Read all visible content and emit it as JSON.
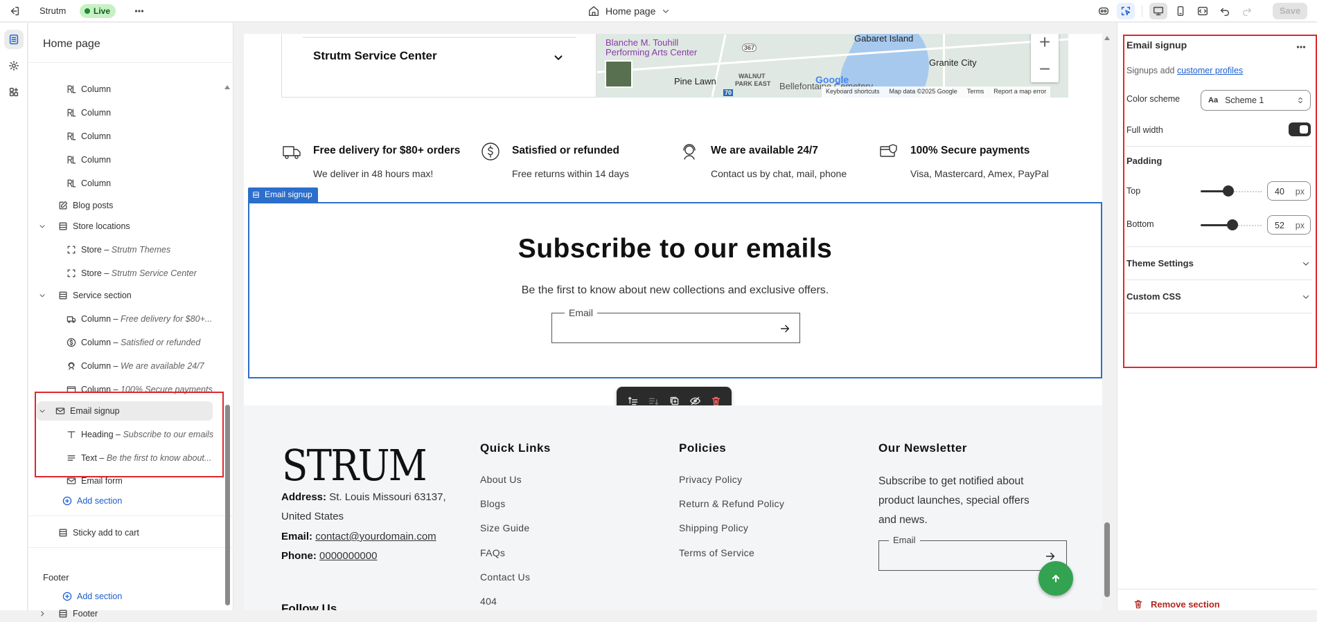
{
  "topbar": {
    "store_name": "Strutm",
    "status": "Live",
    "page_selector": "Home page",
    "save_label": "Save"
  },
  "tree": {
    "title": "Home page",
    "rows": {
      "col1": "Column",
      "col2": "Column",
      "col3": "Column",
      "col4": "Column",
      "col5": "Column",
      "blog_posts": "Blog posts",
      "store_locations": "Store locations",
      "store1_prefix": "Store – ",
      "store1_name": "Strutm Themes",
      "store2_prefix": "Store – ",
      "store2_name": "Strutm Service Center",
      "service_section": "Service section",
      "svc1_prefix": "Column – ",
      "svc1_name": "Free delivery for $80+...",
      "svc2_prefix": "Column – ",
      "svc2_name": "Satisfied or refunded",
      "svc3_prefix": "Column – ",
      "svc3_name": "We are available 24/7",
      "svc4_prefix": "Column – ",
      "svc4_name": "100% Secure payments",
      "email_signup": "Email signup",
      "heading_prefix": "Heading – ",
      "heading_name": "Subscribe to our emails",
      "text_prefix": "Text – ",
      "text_name": "Be the first to know about...",
      "email_form": "Email form",
      "add_section": "Add section",
      "sticky_add_to_cart": "Sticky add to cart",
      "footer_group": "Footer",
      "footer_add_section": "Add section",
      "footer": "Footer"
    }
  },
  "preview": {
    "store_center_name": "Strutm Service Center",
    "map": {
      "labels": [
        "Blanche M. Touhill",
        "Performing Arts Center",
        "Gabaret Island",
        "Granite City",
        "Pine Lawn",
        "WALNUT",
        "PARK EAST",
        "Bellefontaine Cemetery",
        "367",
        "70"
      ],
      "google": "Google",
      "attribution": [
        "Keyboard shortcuts",
        "Map data ©2025 Google",
        "Terms",
        "Report a map error"
      ]
    },
    "services": [
      {
        "title": "Free delivery for $80+ orders",
        "text": "We deliver in 48 hours max!"
      },
      {
        "title": "Satisfied or refunded",
        "text": "Free returns within 14 days"
      },
      {
        "title": "We are available 24/7",
        "text": "Contact us by chat, mail, phone"
      },
      {
        "title": "100% Secure payments",
        "text": "Visa, Mastercard, Amex, PayPal"
      }
    ],
    "selected_tag": "Email signup",
    "email_signup": {
      "heading": "Subscribe to our emails",
      "subtext": "Be the first to know about new collections and exclusive offers.",
      "email_label": "Email"
    },
    "footer": {
      "logo": "STRUM",
      "address_label": "Address:",
      "address_value": "St. Louis Missouri 63137,",
      "address_line2": "United States",
      "email_label": "Email:",
      "email_value": "contact@yourdomain.com",
      "phone_label": "Phone:",
      "phone_value": "0000000000",
      "follow_us": "Follow Us",
      "quick_links_title": "Quick Links",
      "quick_links": [
        "About Us",
        "Blogs",
        "Size Guide",
        "FAQs",
        "Contact Us",
        "404"
      ],
      "policies_title": "Policies",
      "policies": [
        "Privacy Policy",
        "Return & Refund Policy",
        "Shipping Policy",
        "Terms of Service"
      ],
      "newsletter_title": "Our Newsletter",
      "newsletter_text": "Subscribe to get notified about product launches, special offers and news.",
      "newsletter_email_label": "Email"
    }
  },
  "settings": {
    "title": "Email signup",
    "desc_prefix": "Signups add ",
    "desc_link": "customer profiles",
    "color_scheme_label": "Color scheme",
    "color_scheme_icon_text": "Aa",
    "color_scheme_value": "Scheme 1",
    "full_width_label": "Full width",
    "full_width_on": true,
    "padding_title": "Padding",
    "top_label": "Top",
    "top_value": "40",
    "top_fraction": 0.44,
    "bottom_label": "Bottom",
    "bottom_value": "52",
    "bottom_fraction": 0.53,
    "unit": "px",
    "theme_settings": "Theme Settings",
    "custom_css": "Custom CSS",
    "remove_section": "Remove section"
  },
  "colors": {
    "accent": "#2c6ecb",
    "live_badge_bg": "#c7f1c4",
    "highlight_red": "#e0262b",
    "danger": "#b3261e",
    "fab_green": "#33a352"
  },
  "icons": [
    "exit-icon",
    "more-icon",
    "home-icon",
    "chevron-down-icon",
    "eye-icon",
    "select-icon",
    "desktop-icon",
    "mobile-icon",
    "fullscreen-icon",
    "undo-icon",
    "redo-icon",
    "sections-icon",
    "gear-icon",
    "apps-icon"
  ]
}
